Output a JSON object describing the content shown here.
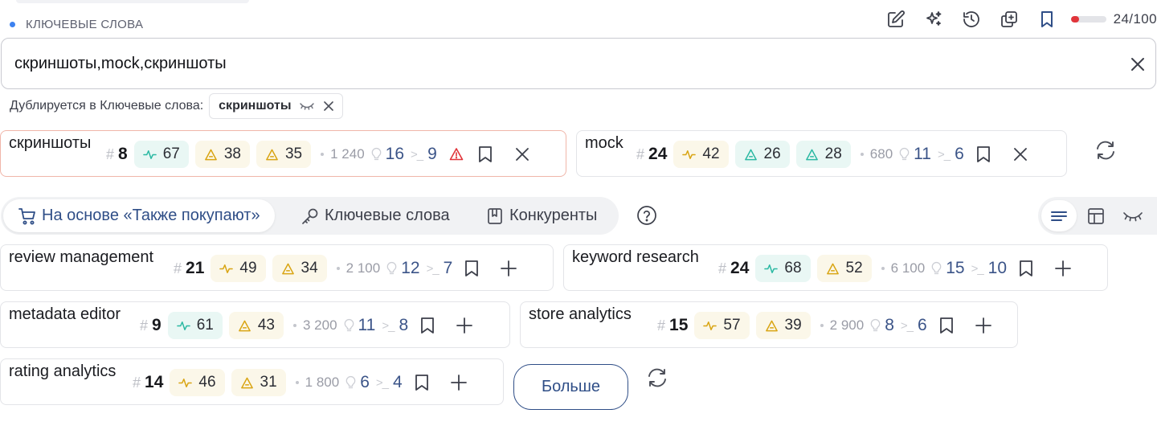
{
  "section": {
    "title": "КЛЮЧЕВЫЕ СЛОВА",
    "quota_text": "24/100",
    "quota_used": 24,
    "quota_total": 100
  },
  "toolbar_icons": [
    "edit-icon",
    "sparkles-icon",
    "history-icon",
    "copy-icon",
    "bookmark-icon"
  ],
  "search": {
    "value": "скриншоты,mock,скриншоты"
  },
  "duplicate": {
    "label": "Дублируется в Ключевые слова:",
    "chip": "скриншоты"
  },
  "selected": [
    {
      "name": "скриншоты",
      "rank": "8",
      "pill1": "67",
      "pill1_kind": "teal",
      "pill2": "38",
      "pill3": "35",
      "pill3_kind": "yellow",
      "volume": "1 240",
      "v1": "16",
      "v2": "9",
      "alert": true
    },
    {
      "name": "mock",
      "rank": "24",
      "pill1": "42",
      "pill1_kind": "yellow",
      "pill2": "26",
      "pill3": "28",
      "pill3_kind": "teal",
      "volume": "680",
      "v1": "11",
      "v2": "6",
      "alert": false
    }
  ],
  "tabs": [
    {
      "label": "На основе «Также покупают»",
      "icon": "cart-icon",
      "active": true
    },
    {
      "label": "Ключевые слова",
      "icon": "key-icon",
      "active": false
    },
    {
      "label": "Конкуренты",
      "icon": "book-icon",
      "active": false
    }
  ],
  "suggestions": [
    {
      "name": "review management",
      "rank": "21",
      "pill1": "49",
      "pill1_kind": "yellow",
      "pill2": "34",
      "volume": "2 100",
      "v1": "12",
      "v2": "7"
    },
    {
      "name": "keyword research",
      "rank": "24",
      "pill1": "68",
      "pill1_kind": "teal",
      "pill2": "52",
      "volume": "6 100",
      "v1": "15",
      "v2": "10"
    },
    {
      "name": "metadata editor",
      "rank": "9",
      "pill1": "61",
      "pill1_kind": "teal",
      "pill2": "43",
      "volume": "3 200",
      "v1": "11",
      "v2": "8"
    },
    {
      "name": "store analytics",
      "rank": "15",
      "pill1": "57",
      "pill1_kind": "yellow",
      "pill2": "39",
      "volume": "2 900",
      "v1": "8",
      "v2": "6"
    },
    {
      "name": "rating analytics",
      "rank": "14",
      "pill1": "46",
      "pill1_kind": "yellow",
      "pill2": "31",
      "volume": "1 800",
      "v1": "6",
      "v2": "4"
    }
  ],
  "more_button": "Больше",
  "colors": {
    "accent": "#2f4e87",
    "teal": "#2cb9a3",
    "yellow": "#d9a514",
    "alert": "#e1353b",
    "quota": "#e1353b"
  }
}
